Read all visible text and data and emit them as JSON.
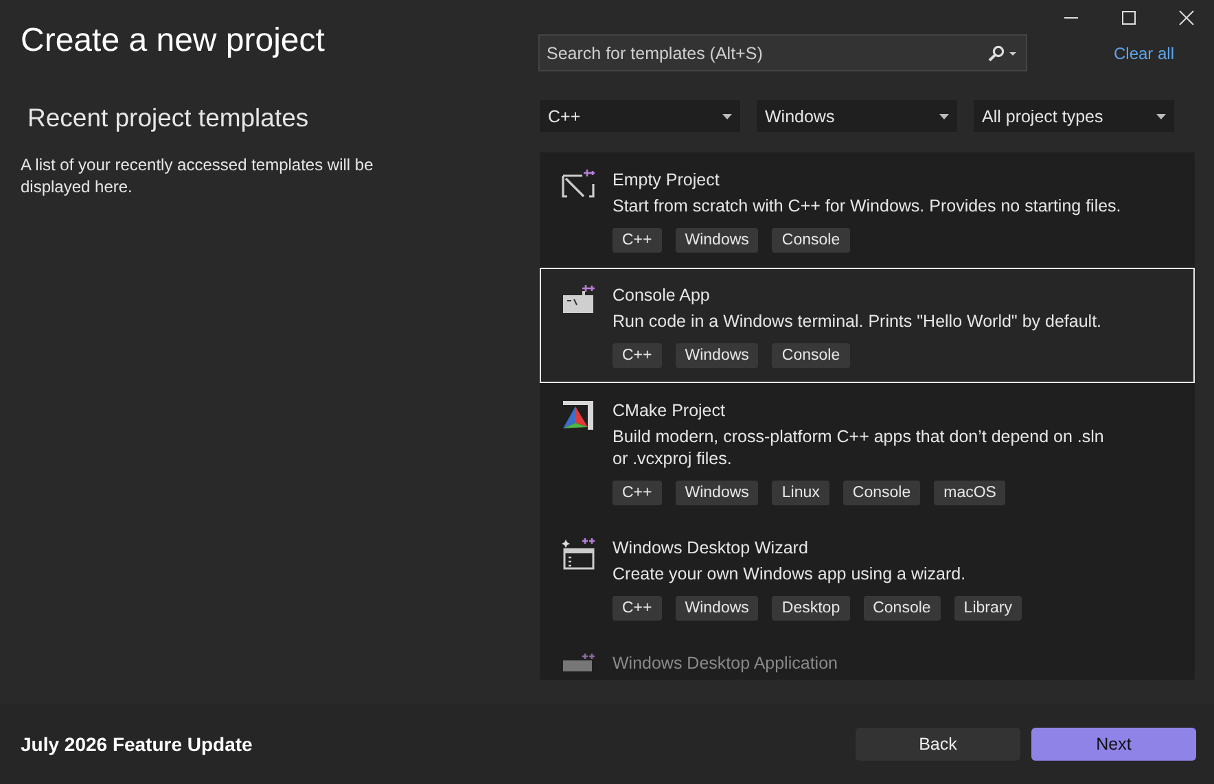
{
  "window": {
    "title": "Create a new project"
  },
  "recent": {
    "heading": "Recent project templates",
    "description": "A list of your recently accessed templates will be displayed here."
  },
  "search": {
    "placeholder": "Search for templates (Alt+S)"
  },
  "clear_all": "Clear all",
  "filters": [
    "C++",
    "Windows",
    "All project types"
  ],
  "templates": [
    {
      "kind": "empty",
      "title": "Empty Project",
      "description": "Start from scratch with C++ for Windows. Provides no starting files.",
      "tags": [
        "C++",
        "Windows",
        "Console"
      ],
      "selected": false
    },
    {
      "kind": "console",
      "title": "Console App",
      "description": "Run code in a Windows terminal. Prints \"Hello World\" by default.",
      "tags": [
        "C++",
        "Windows",
        "Console"
      ],
      "selected": true
    },
    {
      "kind": "cmake",
      "title": "CMake Project",
      "description": "Build modern, cross-platform C++ apps that don’t depend on .sln or .vcxproj files.",
      "tags": [
        "C++",
        "Windows",
        "Linux",
        "Console",
        "macOS"
      ],
      "selected": false
    },
    {
      "kind": "wizard",
      "title": "Windows Desktop Wizard",
      "description": "Create your own Windows app using a wizard.",
      "tags": [
        "C++",
        "Windows",
        "Desktop",
        "Console",
        "Library"
      ],
      "selected": false
    },
    {
      "kind": "desktop",
      "title": "Windows Desktop Application",
      "selected": false
    }
  ],
  "footer": {
    "version": "July 2026 Feature Update",
    "buttons": [
      {
        "label": "Back",
        "kind": "secondary"
      },
      {
        "label": "Next",
        "kind": "primary"
      }
    ]
  }
}
